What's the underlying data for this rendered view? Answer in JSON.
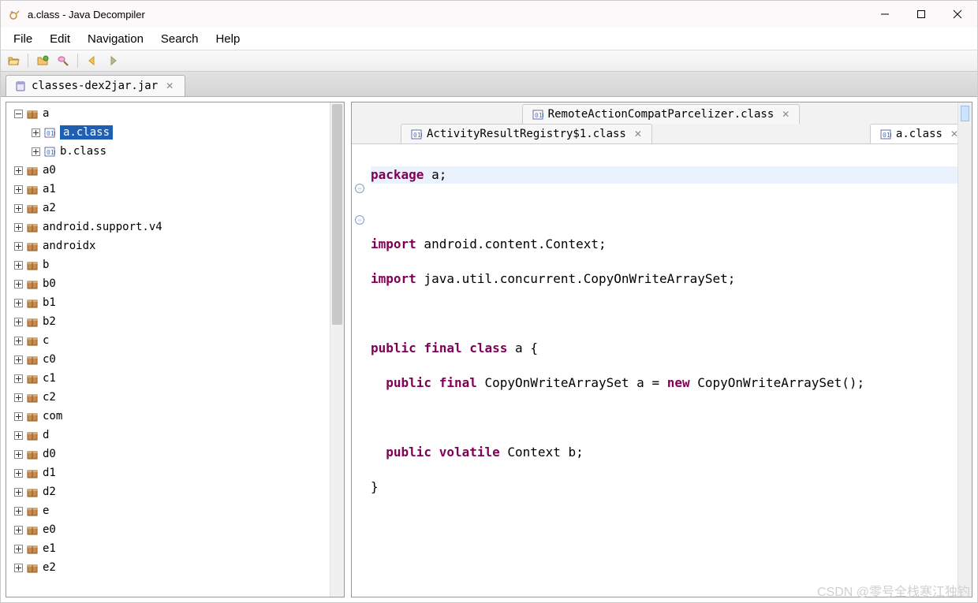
{
  "window": {
    "title": "a.class - Java Decompiler"
  },
  "menu": {
    "file": "File",
    "edit": "Edit",
    "navigation": "Navigation",
    "search": "Search",
    "help": "Help"
  },
  "filetab": {
    "name": "classes-dex2jar.jar"
  },
  "tree": {
    "root": {
      "label": "a",
      "expanded": true
    },
    "children_of_root": [
      {
        "label": "a.class",
        "type": "class",
        "selected": true
      },
      {
        "label": "b.class",
        "type": "class",
        "selected": false
      }
    ],
    "siblings": [
      {
        "label": "a0"
      },
      {
        "label": "a1"
      },
      {
        "label": "a2"
      },
      {
        "label": "android.support.v4"
      },
      {
        "label": "androidx"
      },
      {
        "label": "b"
      },
      {
        "label": "b0"
      },
      {
        "label": "b1"
      },
      {
        "label": "b2"
      },
      {
        "label": "c"
      },
      {
        "label": "c0"
      },
      {
        "label": "c1"
      },
      {
        "label": "c2"
      },
      {
        "label": "com"
      },
      {
        "label": "d"
      },
      {
        "label": "d0"
      },
      {
        "label": "d1"
      },
      {
        "label": "d2"
      },
      {
        "label": "e"
      },
      {
        "label": "e0"
      },
      {
        "label": "e1"
      },
      {
        "label": "e2"
      }
    ]
  },
  "editor": {
    "tabs": {
      "row1": [
        {
          "label": "RemoteActionCompatParcelizer.class",
          "active": false
        }
      ],
      "row2": [
        {
          "label": "ActivityResultRegistry$1.class",
          "active": false
        },
        {
          "label": "a.class",
          "active": true
        }
      ]
    }
  },
  "code": {
    "kw_package": "package",
    "pkg_name": " a;",
    "kw_import": "import",
    "import1_rest": " android.content.Context;",
    "import2_rest": " java.util.concurrent.CopyOnWriteArraySet;",
    "kw_public": "public",
    "kw_final": "final",
    "kw_class": "class",
    "cls_decl_rest": " a {",
    "field1_mid": "CopyOnWriteArraySet a = ",
    "kw_new": "new",
    "field1_tail": " CopyOnWriteArraySet();",
    "kw_volatile": "volatile",
    "field2_tail": " Context b;",
    "closebrace": "}"
  },
  "watermark": "CSDN @零号全栈寒江独钓"
}
